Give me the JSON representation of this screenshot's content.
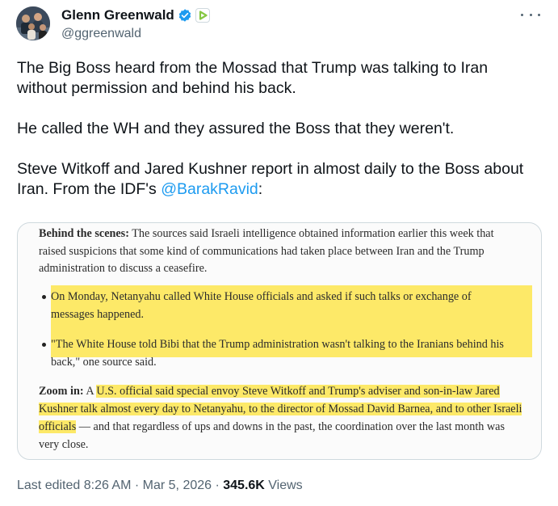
{
  "author": {
    "display_name": "Glenn Greenwald",
    "handle": "@ggreenwald",
    "avatar_icon": "group-photo-avatar",
    "verified_icon": "verified-badge-icon",
    "affiliate_icon": "rumble-logo-icon"
  },
  "tweet": {
    "p1": "The Big Boss heard from the Mossad that Trump was talking to Iran without permission and behind his back.",
    "p2": "He called the WH and they assured the Boss that they weren't.",
    "p3_text": "Steve Witkoff and Jared Kushner report in almost daily  to the Boss about Iran. From the IDF's ",
    "p3_mention": "@BarakRavid",
    "p3_end": ":"
  },
  "clipping": {
    "para1_bold": "Behind the scenes:",
    "para1_text": " The sources said Israeli intelligence obtained information earlier this week that raised suspicions that some kind of communications had taken place between Iran and the Trump administration to discuss a ceasefire.",
    "bullet1": "On Monday, Netanyahu called White House officials and asked if such talks or exchange of messages happened.",
    "bullet2": "\"The White House told Bibi that the Trump administration wasn't talking to the Iranians behind his back,\" one source said.",
    "para2_bold": "Zoom in:",
    "para2_pre": " A ",
    "para2_hl": "U.S. official said special envoy Steve Witkoff and Trump's adviser and son-in-law Jared Kushner talk almost every day to Netanyahu, to the director of Mossad David Barnea, and to other Israeli officials",
    "para2_rest": " — and that regardless of ups and downs in the past, the coordination over the last month was very close."
  },
  "footer": {
    "edited": "Last edited 8:26 AM · Mar 5, 2026 · ",
    "views_count": "345.6K",
    "views_label": " Views"
  },
  "colors": {
    "link": "#1d9bf0",
    "verified": "#1d9bf0",
    "highlight": "#fde968",
    "affiliate": "#85c742"
  }
}
